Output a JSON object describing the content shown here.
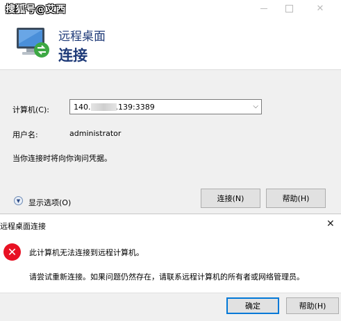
{
  "watermark": "搜狐号@艾西",
  "header": {
    "app_name": "远程桌面",
    "title": "连接"
  },
  "form": {
    "computer_label": "计算机(C):",
    "computer_value_prefix": "140.",
    "computer_value_suffix": ".139:3389",
    "username_label": "用户名:",
    "username_value": "administrator",
    "hint": "当你连接时将向你询问凭据。",
    "options_label": "显示选项(O)"
  },
  "buttons": {
    "connect": "连接(N)",
    "help": "帮助(H)"
  },
  "error_dialog": {
    "title": "远程桌面连接",
    "message": "此计算机无法连接到远程计算机。",
    "detail": "请尝试重新连接。如果问题仍然存在，请联系远程计算机的所有者或网络管理员。",
    "ok": "确定",
    "help": "帮助(H)"
  },
  "icons": {
    "app": "remote-desktop-icon",
    "error": "error-icon",
    "expand": "chevron-down-icon"
  },
  "colors": {
    "title_blue": "#1e3a78",
    "focus_border": "#0078d7",
    "error_red": "#e81123"
  }
}
